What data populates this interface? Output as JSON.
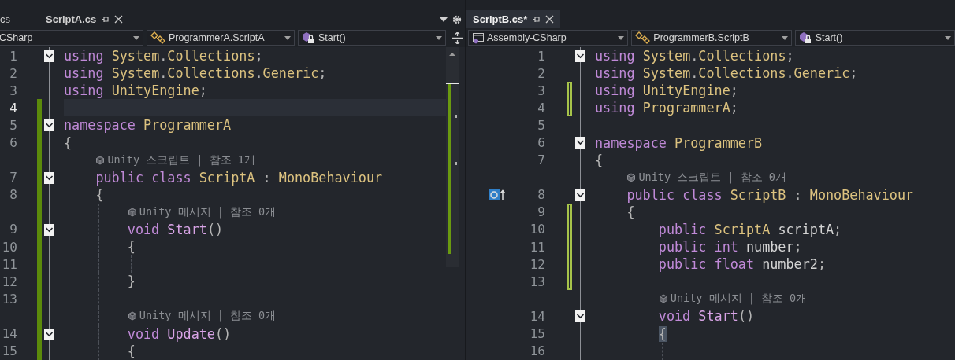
{
  "panes": [
    {
      "kind": "left",
      "tabs": [
        {
          "label": "cs",
          "kind": "clipped",
          "selected": false
        },
        {
          "label": "ScriptA.cs",
          "kind": "file",
          "selected": false
        }
      ],
      "nav": [
        {
          "label": "CSharp"
        },
        {
          "label": "ProgrammerA.ScriptA",
          "kind": "class"
        },
        {
          "label": "Start()",
          "kind": "method"
        }
      ],
      "lines": [
        {
          "kind": "code",
          "number": "1",
          "expanded": true,
          "current": false,
          "tokens": [
            {
              "t": "using ",
              "kind": "keyword"
            },
            {
              "t": "System",
              "kind": "type"
            },
            {
              "t": ".",
              "kind": "punct"
            },
            {
              "t": "Collections",
              "kind": "type"
            },
            {
              "t": ";",
              "kind": "punct"
            }
          ]
        },
        {
          "kind": "code",
          "number": "2",
          "current": false,
          "tokens": [
            {
              "t": "using ",
              "kind": "keyword"
            },
            {
              "t": "System",
              "kind": "type"
            },
            {
              "t": ".",
              "kind": "punct"
            },
            {
              "t": "Collections",
              "kind": "type"
            },
            {
              "t": ".",
              "kind": "punct"
            },
            {
              "t": "Generic",
              "kind": "type"
            },
            {
              "t": ";",
              "kind": "punct"
            }
          ]
        },
        {
          "kind": "code",
          "number": "3",
          "current": false,
          "tokens": [
            {
              "t": "using ",
              "kind": "keyword"
            },
            {
              "t": "UnityEngine",
              "kind": "type"
            },
            {
              "t": ";",
              "kind": "punct"
            }
          ]
        },
        {
          "kind": "code",
          "number": "4",
          "current": true,
          "modified": true,
          "saved": true
        },
        {
          "kind": "code",
          "number": "5",
          "expanded": true,
          "current": false,
          "modified": true,
          "saved": true,
          "tokens": [
            {
              "t": "namespace ",
              "kind": "keyword"
            },
            {
              "t": "ProgrammerA",
              "kind": "type"
            }
          ]
        },
        {
          "kind": "code",
          "number": "6",
          "current": false,
          "modified": true,
          "saved": true,
          "tokens": [
            {
              "t": "{",
              "kind": "punct"
            }
          ]
        },
        {
          "kind": "lens",
          "text": "Unity 스크립트 | 참조 1개",
          "modified": true,
          "saved": true
        },
        {
          "kind": "code",
          "number": "7",
          "expanded": true,
          "current": false,
          "modified": true,
          "saved": true,
          "tokens": [
            {
              "t": "public class ",
              "kind": "keyword"
            },
            {
              "t": "ScriptA",
              "kind": "type"
            },
            {
              "t": " : ",
              "kind": "punct"
            },
            {
              "t": "MonoBehaviour",
              "kind": "type"
            }
          ]
        },
        {
          "kind": "code",
          "number": "8",
          "current": false,
          "modified": true,
          "saved": true,
          "tokens": [
            {
              "t": "{",
              "kind": "punct"
            }
          ]
        },
        {
          "kind": "lens",
          "text": "Unity 메시지 | 참조 0개",
          "modified": true,
          "saved": true
        },
        {
          "kind": "code",
          "number": "9",
          "expanded": true,
          "current": false,
          "modified": true,
          "saved": true,
          "tokens": [
            {
              "t": "void ",
              "kind": "keyword"
            },
            {
              "t": "Start",
              "kind": "method"
            },
            {
              "t": "()",
              "kind": "punct"
            }
          ]
        },
        {
          "kind": "code",
          "number": "10",
          "current": false,
          "modified": true,
          "saved": true,
          "tokens": [
            {
              "t": "{",
              "kind": "punct"
            }
          ]
        },
        {
          "kind": "code",
          "number": "11",
          "current": false,
          "modified": true,
          "saved": true
        },
        {
          "kind": "code",
          "number": "12",
          "current": false,
          "modified": true,
          "saved": true,
          "tokens": [
            {
              "t": "}",
              "kind": "punct"
            }
          ]
        },
        {
          "kind": "code",
          "number": "13",
          "current": false,
          "modified": true,
          "saved": true
        },
        {
          "kind": "lens",
          "text": "Unity 메시지 | 참조 0개",
          "modified": true,
          "saved": true
        },
        {
          "kind": "code",
          "number": "14",
          "expanded": true,
          "current": false,
          "modified": true,
          "saved": true,
          "tokens": [
            {
              "t": "void ",
              "kind": "keyword"
            },
            {
              "t": "Update",
              "kind": "method"
            },
            {
              "t": "()",
              "kind": "punct"
            }
          ]
        },
        {
          "kind": "code",
          "number": "15",
          "current": false,
          "modified": true,
          "saved": true,
          "tokens": [
            {
              "t": "{",
              "kind": "punct"
            }
          ]
        }
      ]
    },
    {
      "kind": "right",
      "tabs": [
        {
          "label": "ScriptB.cs*",
          "kind": "file",
          "selected": true
        }
      ],
      "nav": [
        {
          "label": "Assembly-CSharp",
          "kind": "project"
        },
        {
          "label": "ProgrammerB.ScriptB",
          "kind": "class"
        },
        {
          "label": "Start()",
          "kind": "method"
        }
      ],
      "lines": [
        {
          "kind": "code",
          "number": "1",
          "expanded": true,
          "current": false,
          "tokens": [
            {
              "t": "using ",
              "kind": "keyword"
            },
            {
              "t": "System",
              "kind": "type"
            },
            {
              "t": ".",
              "kind": "punct"
            },
            {
              "t": "Collections",
              "kind": "type"
            },
            {
              "t": ";",
              "kind": "punct"
            }
          ]
        },
        {
          "kind": "code",
          "number": "2",
          "current": false,
          "tokens": [
            {
              "t": "using ",
              "kind": "keyword"
            },
            {
              "t": "System",
              "kind": "type"
            },
            {
              "t": ".",
              "kind": "punct"
            },
            {
              "t": "Collections",
              "kind": "type"
            },
            {
              "t": ".",
              "kind": "punct"
            },
            {
              "t": "Generic",
              "kind": "type"
            },
            {
              "t": ";",
              "kind": "punct"
            }
          ]
        },
        {
          "kind": "code",
          "number": "3",
          "current": false,
          "modified": true,
          "saved": false,
          "tokens": [
            {
              "t": "using ",
              "kind": "keyword"
            },
            {
              "t": "UnityEngine",
              "kind": "type"
            },
            {
              "t": ";",
              "kind": "punct"
            }
          ]
        },
        {
          "kind": "code",
          "number": "4",
          "current": false,
          "modified": true,
          "saved": false,
          "tokens": [
            {
              "t": "using ",
              "kind": "keyword"
            },
            {
              "t": "ProgrammerA",
              "kind": "type"
            },
            {
              "t": ";",
              "kind": "punct"
            }
          ]
        },
        {
          "kind": "code",
          "number": "5",
          "current": false
        },
        {
          "kind": "code",
          "number": "6",
          "expanded": true,
          "current": false,
          "tokens": [
            {
              "t": "namespace ",
              "kind": "keyword"
            },
            {
              "t": "ProgrammerB",
              "kind": "type"
            }
          ]
        },
        {
          "kind": "code",
          "number": "7",
          "current": false,
          "tokens": [
            {
              "t": "{",
              "kind": "punct"
            }
          ]
        },
        {
          "kind": "lens",
          "text": "Unity 스크립트 | 참조 0개"
        },
        {
          "kind": "code",
          "number": "8",
          "expanded": true,
          "current": false,
          "inherits": true,
          "tokens": [
            {
              "t": "public class ",
              "kind": "keyword"
            },
            {
              "t": "ScriptB",
              "kind": "type"
            },
            {
              "t": " : ",
              "kind": "punct"
            },
            {
              "t": "MonoBehaviour",
              "kind": "type"
            }
          ]
        },
        {
          "kind": "code",
          "number": "9",
          "current": false,
          "modified": true,
          "saved": false,
          "tokens": [
            {
              "t": "{",
              "kind": "punct"
            }
          ]
        },
        {
          "kind": "code",
          "number": "10",
          "current": false,
          "modified": true,
          "saved": false,
          "tokens": [
            {
              "t": "public ",
              "kind": "keyword"
            },
            {
              "t": "ScriptA ",
              "kind": "type"
            },
            {
              "t": "scriptA",
              "kind": "plain"
            },
            {
              "t": ";",
              "kind": "punct"
            }
          ]
        },
        {
          "kind": "code",
          "number": "11",
          "current": false,
          "modified": true,
          "saved": false,
          "tokens": [
            {
              "t": "public int ",
              "kind": "keyword"
            },
            {
              "t": "number",
              "kind": "plain"
            },
            {
              "t": ";",
              "kind": "punct"
            }
          ]
        },
        {
          "kind": "code",
          "number": "12",
          "current": false,
          "modified": true,
          "saved": false,
          "tokens": [
            {
              "t": "public float ",
              "kind": "keyword"
            },
            {
              "t": "number2",
              "kind": "plain"
            },
            {
              "t": ";",
              "kind": "punct"
            }
          ]
        },
        {
          "kind": "code",
          "number": "13",
          "current": false,
          "modified": true,
          "saved": false
        },
        {
          "kind": "lens",
          "text": "Unity 메시지 | 참조 0개"
        },
        {
          "kind": "code",
          "number": "14",
          "expanded": true,
          "current": false,
          "tokens": [
            {
              "t": "void ",
              "kind": "keyword"
            },
            {
              "t": "Start",
              "kind": "method"
            },
            {
              "t": "()",
              "kind": "punct"
            }
          ]
        },
        {
          "kind": "code",
          "number": "15",
          "current": false,
          "tokens": [
            {
              "t": "{",
              "kind": "punct",
              "highlighted": true
            }
          ]
        },
        {
          "kind": "code",
          "number": "16",
          "current": false
        }
      ]
    }
  ]
}
